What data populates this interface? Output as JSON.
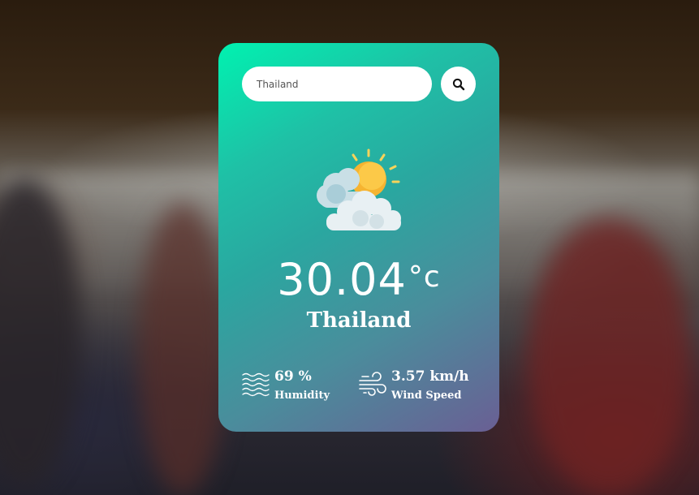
{
  "search": {
    "value": "Thailand",
    "button_icon": "search-icon"
  },
  "weather": {
    "icon": "partly-cloudy-sun-icon",
    "temperature": "30.04",
    "unit": "°c",
    "city": "Thailand"
  },
  "details": {
    "humidity": {
      "icon": "humidity-waves-icon",
      "value": "69 %",
      "label": "Humidity"
    },
    "wind": {
      "icon": "wind-icon",
      "value": "3.57 km/h",
      "label": "Wind Speed"
    }
  },
  "colors": {
    "card_gradient_start": "#00f2b0",
    "card_gradient_end": "#6a5f94",
    "text": "#ffffff"
  }
}
